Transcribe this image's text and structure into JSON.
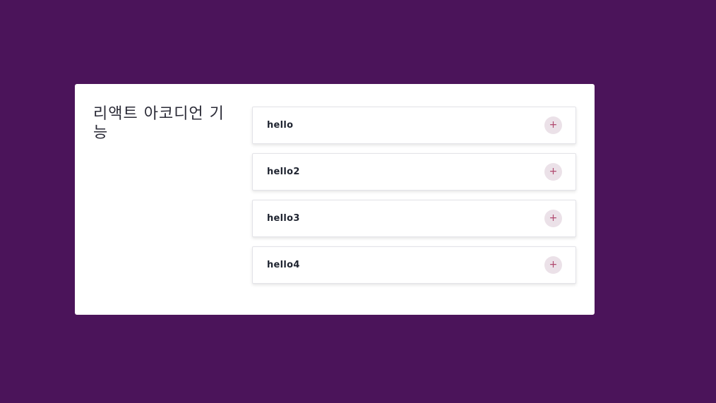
{
  "page": {
    "background": "#4b145a"
  },
  "card": {
    "title": "리액트 아코디언 기능"
  },
  "accordion": {
    "items": [
      {
        "label": "hello",
        "toggle_icon": "plus-icon",
        "toggle_symbol": "+"
      },
      {
        "label": "hello2",
        "toggle_icon": "plus-icon",
        "toggle_symbol": "+"
      },
      {
        "label": "hello3",
        "toggle_icon": "plus-icon",
        "toggle_symbol": "+"
      },
      {
        "label": "hello4",
        "toggle_icon": "plus-icon",
        "toggle_symbol": "+"
      }
    ],
    "accent_color": "#b0486e"
  }
}
